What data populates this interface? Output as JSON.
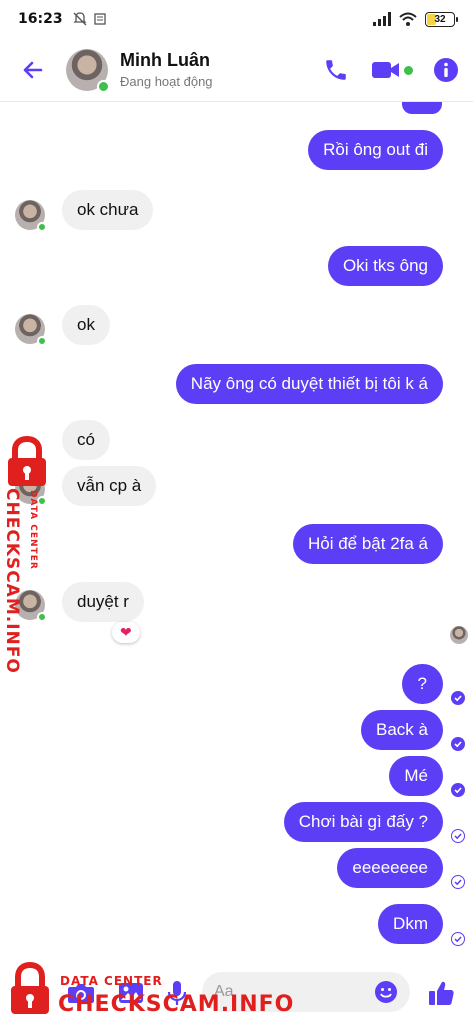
{
  "status_bar": {
    "time": "16:23",
    "battery": "32"
  },
  "header": {
    "contact_name": "Minh Luân",
    "contact_status": "Đang hoạt động"
  },
  "messages": [
    {
      "dir": "out",
      "text": "Rồi ông out đi"
    },
    {
      "dir": "in",
      "text": "ok chưa"
    },
    {
      "dir": "out",
      "text": "Oki tks ông"
    },
    {
      "dir": "in",
      "text": "ok"
    },
    {
      "dir": "out",
      "text": "Nãy ông có duyệt thiết bị tôi k á"
    },
    {
      "dir": "in",
      "text": "có"
    },
    {
      "dir": "in",
      "text": "vẫn cp à"
    },
    {
      "dir": "out",
      "text": "Hỏi để bật 2fa á"
    },
    {
      "dir": "in",
      "text": "duyệt r",
      "reaction": "❤"
    },
    {
      "dir": "out",
      "text": "?"
    },
    {
      "dir": "out",
      "text": "Back à"
    },
    {
      "dir": "out",
      "text": "Mé"
    },
    {
      "dir": "out",
      "text": "Chơi bài gì đấy ?"
    },
    {
      "dir": "out",
      "text": "eeeeeeee"
    },
    {
      "dir": "out",
      "text": "Dkm"
    }
  ],
  "composer": {
    "placeholder": "Aa"
  },
  "watermark": {
    "vertical_big": "CHECKSCAM.INFO",
    "vertical_small": "DATA CENTER",
    "bottom_small": "DATA CENTER",
    "bottom_big": "CHECKSCAM.INFO"
  },
  "colors": {
    "accent": "#5b3ef5",
    "incoming_bubble": "#f0f0f0",
    "online": "#3dbf4a",
    "watermark": "#e0201e"
  },
  "icons": [
    "back-arrow-icon",
    "phone-icon",
    "video-camera-icon",
    "info-icon",
    "camera-icon",
    "image-icon",
    "microphone-icon",
    "emoji-icon",
    "thumbs-up-icon",
    "lock-icon"
  ]
}
